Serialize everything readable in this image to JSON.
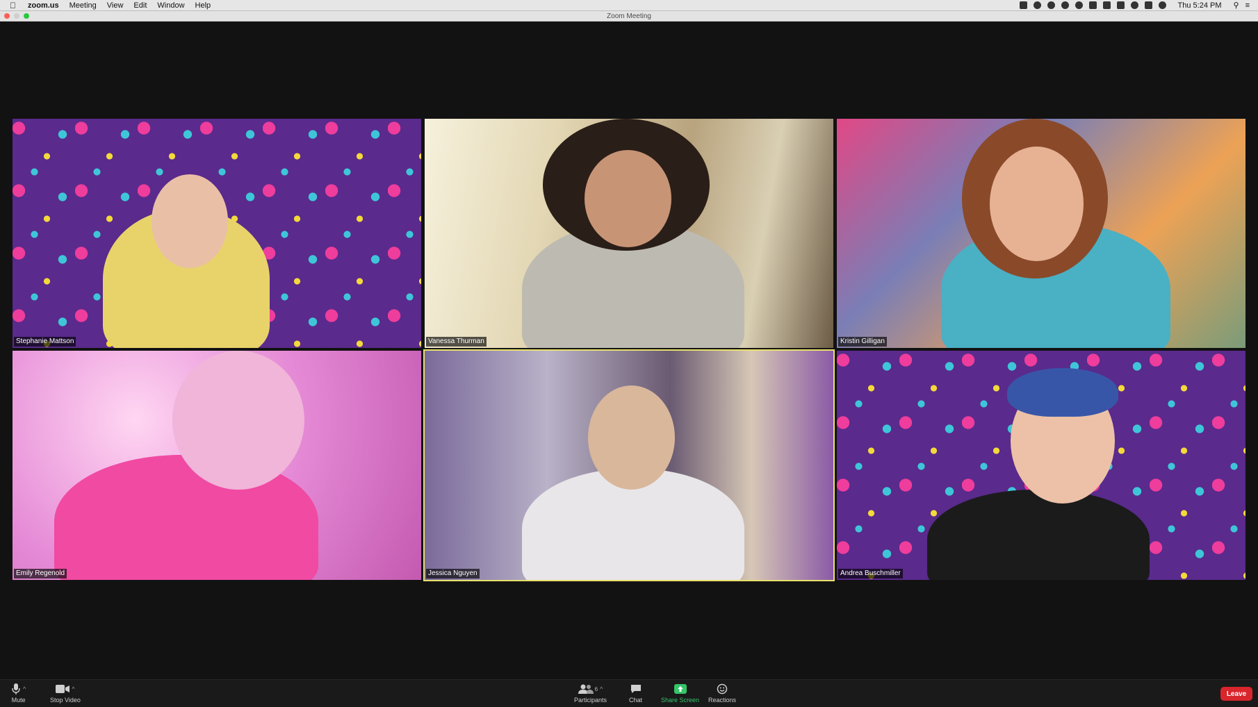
{
  "menubar": {
    "app_name": "zoom.us",
    "items": [
      "Meeting",
      "View",
      "Edit",
      "Window",
      "Help"
    ],
    "clock": "Thu 5:24 PM"
  },
  "window": {
    "title": "Zoom Meeting"
  },
  "participants": [
    {
      "name": "Stephanie Mattson"
    },
    {
      "name": "Vanessa Thurman"
    },
    {
      "name": "Kristin Gilligan"
    },
    {
      "name": "Emily Regenold"
    },
    {
      "name": "Jessica Nguyen",
      "speaking": true
    },
    {
      "name": "Andrea Buschmiller"
    }
  ],
  "toolbar": {
    "mute_label": "Mute",
    "stop_video_label": "Stop Video",
    "participants_label": "Participants",
    "participants_count": "6",
    "chat_label": "Chat",
    "share_screen_label": "Share Screen",
    "reactions_label": "Reactions",
    "leave_label": "Leave"
  },
  "colors": {
    "share_green": "#35c46a",
    "leave_red": "#d9262c",
    "active_speaker": "#e8e16a"
  }
}
